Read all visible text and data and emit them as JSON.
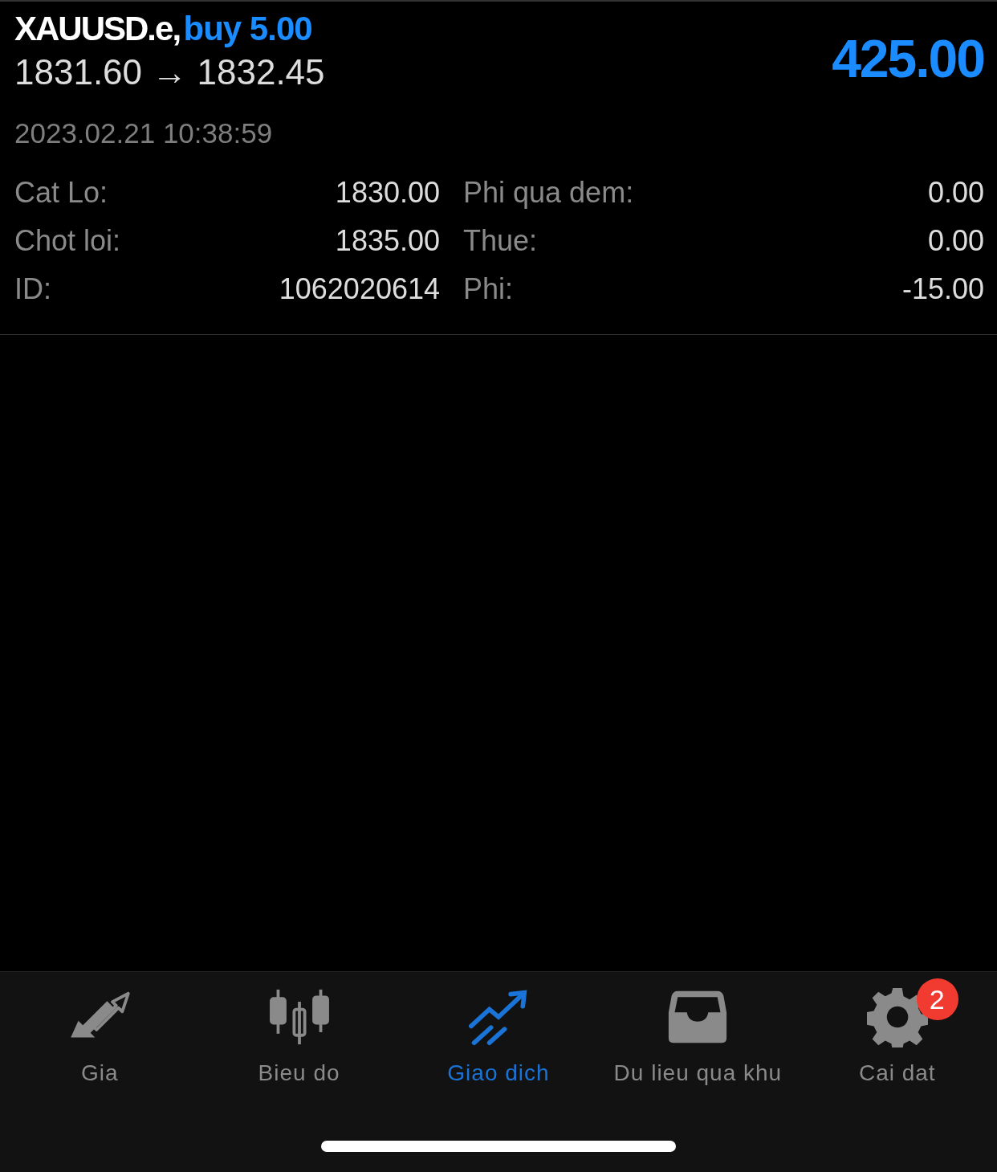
{
  "position": {
    "symbol": "XAUUSD.e,",
    "side": "buy 5.00",
    "prices": "1831.60 → 1832.45",
    "profit": "425.00",
    "time": "2023.02.21 10:38:59",
    "details": [
      {
        "label": "Cat Lo:",
        "value": "1830.00"
      },
      {
        "label": "Phi qua dem:",
        "value": "0.00"
      },
      {
        "label": "Chot loi:",
        "value": "1835.00"
      },
      {
        "label": "Thue:",
        "value": "0.00"
      },
      {
        "label": "ID:",
        "value": "1062020614"
      },
      {
        "label": "Phi:",
        "value": "-15.00"
      }
    ]
  },
  "tabs": [
    {
      "label": "Gia",
      "kind": "quotes",
      "selected": false
    },
    {
      "label": "Bieu do",
      "kind": "chart",
      "selected": false
    },
    {
      "label": "Giao dich",
      "kind": "trade",
      "selected": true
    },
    {
      "label": "Du lieu qua khu",
      "kind": "history",
      "selected": false
    },
    {
      "label": "Cai dat",
      "kind": "settings",
      "selected": false,
      "badge": "2"
    }
  ]
}
